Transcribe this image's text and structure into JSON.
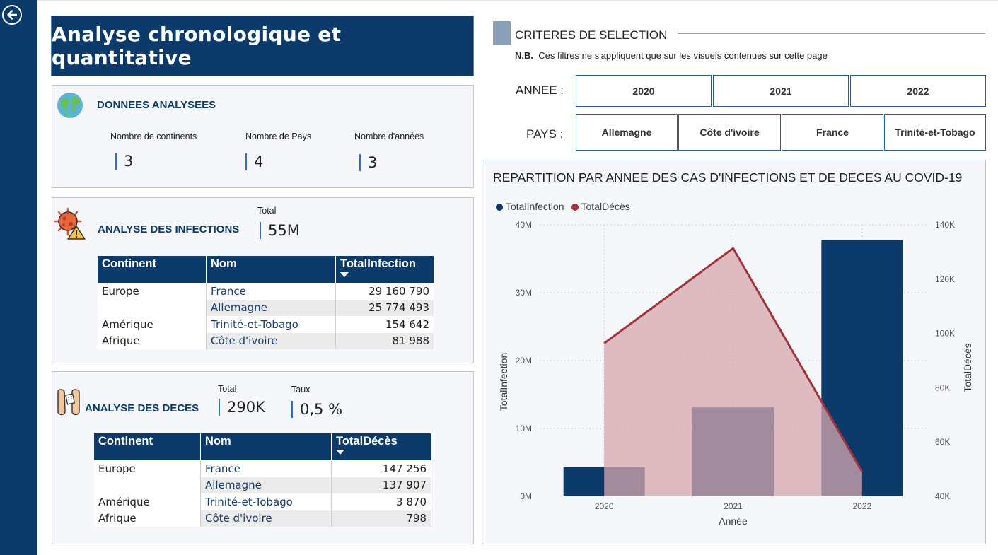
{
  "page": {
    "title": "Analyse chronologique et quantitative"
  },
  "donnees": {
    "title": "DONNEES ANALYSEES",
    "kpis": [
      {
        "label": "Nombre de continents",
        "value": "3"
      },
      {
        "label": "Nombre de Pays",
        "value": "4"
      },
      {
        "label": "Nombre d'années",
        "value": "3"
      }
    ]
  },
  "infections": {
    "title": "ANALYSE DES INFECTIONS",
    "total_label": "Total",
    "total_value": "55M",
    "columns": [
      "Continent",
      "Nom",
      "TotalInfection"
    ],
    "rows": [
      {
        "continent": "Europe",
        "nom": "France",
        "value": "29 160 790"
      },
      {
        "continent": "",
        "nom": "Allemagne",
        "value": "25 774 493"
      },
      {
        "continent": "Amérique",
        "nom": "Trinité-et-Tobago",
        "value": "154 642"
      },
      {
        "continent": "Afrique",
        "nom": "Côte d'ivoire",
        "value": "81 988"
      }
    ]
  },
  "deces": {
    "title": "ANALYSE DES DECES",
    "total_label": "Total",
    "total_value": "290K",
    "taux_label": "Taux",
    "taux_value": "0,5 %",
    "columns": [
      "Continent",
      "Nom",
      "TotalDécès"
    ],
    "rows": [
      {
        "continent": "Europe",
        "nom": "France",
        "value": "147 256"
      },
      {
        "continent": "",
        "nom": "Allemagne",
        "value": "137 907"
      },
      {
        "continent": "Amérique",
        "nom": "Trinité-et-Tobago",
        "value": "3 870"
      },
      {
        "continent": "Afrique",
        "nom": "Côte d'ivoire",
        "value": "798"
      }
    ]
  },
  "criteres": {
    "title": "CRITERES DE SELECTION",
    "note_bold": "N.B.",
    "note_text": "Ces filtres ne s'appliquent que sur les visuels contenues sur cette page",
    "annee_label": "ANNEE :",
    "annees": [
      "2020",
      "2021",
      "2022"
    ],
    "pays_label": "PAYS :",
    "pays": [
      "Allemagne",
      "Côte d'ivoire",
      "France",
      "Trinité-et-Tobago"
    ]
  },
  "colors": {
    "navy": "#0b3a6b",
    "infection": "#0b3a6b",
    "deces_line": "#a1343b",
    "deces_area": "#d4a7ac"
  },
  "chart_data": {
    "type": "bar",
    "title": "REPARTITION PAR ANNEE  DES CAS D'INFECTIONS ET DE DECES AU COVID-19",
    "xlabel": "Année",
    "ylabel": "TotalInfection",
    "y2label": "TotalDécès",
    "categories": [
      "2020",
      "2021",
      "2022"
    ],
    "series": [
      {
        "name": "TotalInfection",
        "type": "bar",
        "axis": "left",
        "values": [
          4300000,
          13100000,
          37800000
        ]
      },
      {
        "name": "TotalDécès",
        "type": "area",
        "axis": "right",
        "values": [
          102000,
          140500,
          50000
        ]
      }
    ],
    "ylim": [
      0,
      40000000
    ],
    "y2lim": [
      40000,
      150000
    ],
    "yticks": [
      "0M",
      "10M",
      "20M",
      "30M",
      "40M"
    ],
    "y2ticks": [
      "40K",
      "60K",
      "80K",
      "100K",
      "120K",
      "140K"
    ],
    "legend": "top-left",
    "grid": true
  }
}
